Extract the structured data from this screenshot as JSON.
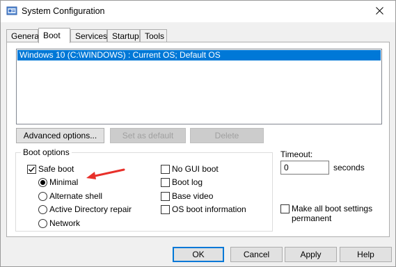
{
  "window": {
    "title": "System Configuration"
  },
  "tabs": [
    {
      "label": "General",
      "active": false
    },
    {
      "label": "Boot",
      "active": true
    },
    {
      "label": "Services",
      "active": false
    },
    {
      "label": "Startup",
      "active": false
    },
    {
      "label": "Tools",
      "active": false
    }
  ],
  "os_list": {
    "items": [
      "Windows 10 (C:\\WINDOWS) : Current OS; Default OS"
    ],
    "selected_index": 0
  },
  "list_buttons": {
    "advanced_options": "Advanced options...",
    "set_as_default": "Set as default",
    "delete": "Delete"
  },
  "boot_options": {
    "label": "Boot options",
    "safe_boot": {
      "label": "Safe boot",
      "checked": true
    },
    "radios": [
      {
        "label": "Minimal",
        "selected": true
      },
      {
        "label": "Alternate shell",
        "selected": false
      },
      {
        "label": "Active Directory repair",
        "selected": false
      },
      {
        "label": "Network",
        "selected": false
      }
    ],
    "checkboxes_right": [
      {
        "label": "No GUI boot",
        "checked": false
      },
      {
        "label": "Boot log",
        "checked": false
      },
      {
        "label": "Base video",
        "checked": false
      },
      {
        "label": "OS boot information",
        "checked": false
      }
    ]
  },
  "timeout": {
    "label": "Timeout:",
    "value": "0",
    "unit": "seconds"
  },
  "make_permanent": {
    "label_line1": "Make all boot settings",
    "label_line2": "permanent",
    "checked": false
  },
  "bottom_buttons": {
    "ok": "OK",
    "cancel": "Cancel",
    "apply": "Apply",
    "help": "Help"
  },
  "colors": {
    "selection": "#0078d7",
    "arrow": "#e8302a",
    "dialog_bg": "#f0f0f0"
  },
  "icons": {
    "app": "msconfig-icon",
    "close": "close-icon",
    "annotation": "red-arrow-icon"
  }
}
